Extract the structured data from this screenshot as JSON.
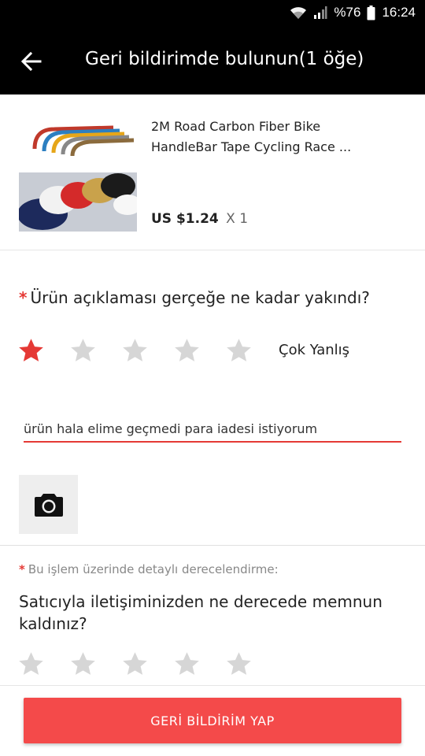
{
  "status_bar": {
    "battery": "%76",
    "time": "16:24",
    "icons": [
      "wifi-icon",
      "signal-icon",
      "battery-icon"
    ]
  },
  "app_bar": {
    "title": "Geri bildirimde bulunun(1 öğe)",
    "back_icon": "arrow-left-icon"
  },
  "product": {
    "name": "2M Road Carbon Fiber Bike HandleBar Tape Cycling Race ...",
    "price": "US $1.24",
    "quantity": "X 1"
  },
  "question1": {
    "required_mark": "*",
    "text": "Ürün açıklaması gerçeğe ne kadar yakındı?",
    "rating": 1,
    "max_rating": 5,
    "rating_text": "Çok Yanlış"
  },
  "comment": {
    "value": "ürün hala elime geçmedi para iadesi istiyorum"
  },
  "photo": {
    "icon": "camera-icon"
  },
  "question2": {
    "required_mark": "*",
    "sub_label": "Bu işlem üzerinde detaylı derecelendirme:",
    "text": "Satıcıyla iletişiminizden ne derecede memnun kaldınız?",
    "rating": 0,
    "max_rating": 5
  },
  "submit_label": "GERİ BİLDİRİM YAP",
  "colors": {
    "accent": "#f44a4a",
    "star_active": "#e53935",
    "star_inactive": "#d6d6d6",
    "bar_bg": "#000000"
  }
}
